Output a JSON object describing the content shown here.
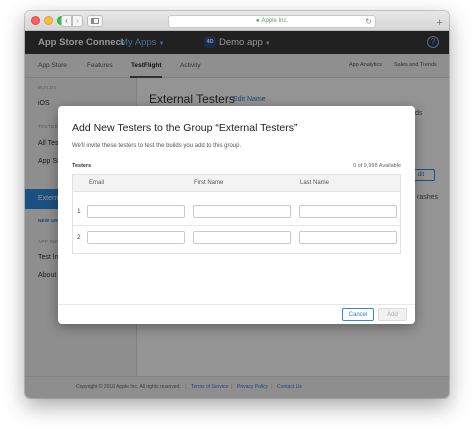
{
  "browser": {
    "url": "Apple Inc.",
    "back_icon": "‹",
    "forward_icon": "›",
    "reload_icon": "↻",
    "new_tab_icon": "+"
  },
  "header": {
    "brand": "App Store Connect",
    "my_apps": "My Apps",
    "app_icon_text": "4D",
    "app_name": "Demo app",
    "help": "?"
  },
  "subnav": {
    "tabs": [
      "App Store",
      "Features",
      "TestFlight",
      "Activity"
    ],
    "active_tab": "TestFlight",
    "right_tabs": [
      "App Analytics",
      "Sales and Trends"
    ]
  },
  "sidebar": {
    "section_builds": "BUILDS",
    "ios": "iOS",
    "section_testers": "TESTERS",
    "all_testers": "All Testers",
    "app_store": "App Store",
    "external_testers": "External Testers",
    "new_group": "NEW GROUP",
    "section_app_info": "APP INFO",
    "test_info": "Test Information",
    "about": "About"
  },
  "main": {
    "title": "External Testers",
    "edit_name": "Edit Name",
    "peek_right_1": "ds",
    "peek_edit": "dit",
    "peek_right_2": "rashes"
  },
  "modal": {
    "title": "Add New Testers to the Group “External Testers”",
    "description": "We'll invite these testers to test the builds you add to this group.",
    "section_label": "Testers",
    "available": "0 of 9,998 Available",
    "columns": [
      "Email",
      "First Name",
      "Last Name"
    ],
    "rows": [
      {
        "num": "1",
        "email": "",
        "first_name": "",
        "last_name": ""
      },
      {
        "num": "2",
        "email": "",
        "first_name": "",
        "last_name": ""
      }
    ],
    "cancel": "Cancel",
    "add": "Add"
  },
  "footer": {
    "copyright": "Copyright © 2018 Apple Inc. All rights reserved.",
    "terms": "Terms of Service",
    "privacy": "Privacy Policy",
    "contact": "Contact Us",
    "separator": "|"
  },
  "colors": {
    "accent": "#2f8be2",
    "header_bg": "#3a3a3a"
  }
}
